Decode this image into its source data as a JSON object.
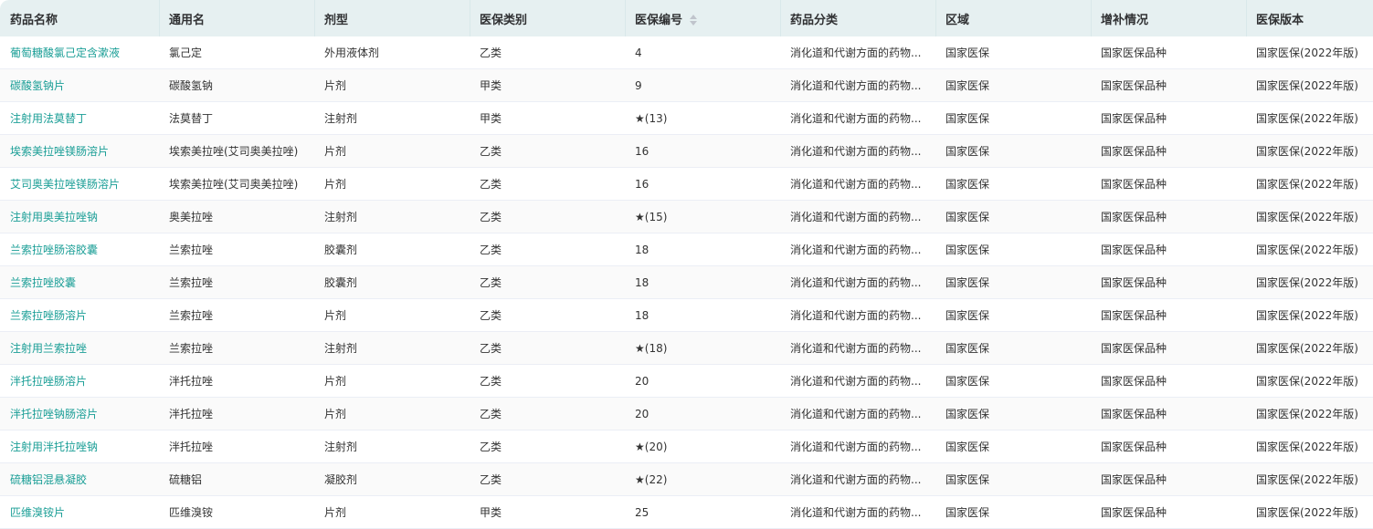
{
  "colors": {
    "link": "#1a9e96",
    "header_bg": "#e6f0f1",
    "stripe": "#fafafa",
    "text": "#333333"
  },
  "table": {
    "headers": [
      "药品名称",
      "通用名",
      "剂型",
      "医保类别",
      "医保编号",
      "药品分类",
      "区域",
      "增补情况",
      "医保版本"
    ],
    "sortable_column": "医保编号",
    "sort_icon": "sort-caret-icon",
    "rows": [
      [
        "葡萄糖酸氯己定含漱液",
        "氯己定",
        "外用液体剂",
        "乙类",
        "4",
        "消化道和代谢方面的药物...",
        "国家医保",
        "国家医保品种",
        "国家医保(2022年版)"
      ],
      [
        "碳酸氢钠片",
        "碳酸氢钠",
        "片剂",
        "甲类",
        "9",
        "消化道和代谢方面的药物...",
        "国家医保",
        "国家医保品种",
        "国家医保(2022年版)"
      ],
      [
        "注射用法莫替丁",
        "法莫替丁",
        "注射剂",
        "甲类",
        "★(13)",
        "消化道和代谢方面的药物...",
        "国家医保",
        "国家医保品种",
        "国家医保(2022年版)"
      ],
      [
        "埃索美拉唑镁肠溶片",
        "埃索美拉唑(艾司奥美拉唑)",
        "片剂",
        "乙类",
        "16",
        "消化道和代谢方面的药物...",
        "国家医保",
        "国家医保品种",
        "国家医保(2022年版)"
      ],
      [
        "艾司奥美拉唑镁肠溶片",
        "埃索美拉唑(艾司奥美拉唑)",
        "片剂",
        "乙类",
        "16",
        "消化道和代谢方面的药物...",
        "国家医保",
        "国家医保品种",
        "国家医保(2022年版)"
      ],
      [
        "注射用奥美拉唑钠",
        "奥美拉唑",
        "注射剂",
        "乙类",
        "★(15)",
        "消化道和代谢方面的药物...",
        "国家医保",
        "国家医保品种",
        "国家医保(2022年版)"
      ],
      [
        "兰索拉唑肠溶胶囊",
        "兰索拉唑",
        "胶囊剂",
        "乙类",
        "18",
        "消化道和代谢方面的药物...",
        "国家医保",
        "国家医保品种",
        "国家医保(2022年版)"
      ],
      [
        "兰索拉唑胶囊",
        "兰索拉唑",
        "胶囊剂",
        "乙类",
        "18",
        "消化道和代谢方面的药物...",
        "国家医保",
        "国家医保品种",
        "国家医保(2022年版)"
      ],
      [
        "兰索拉唑肠溶片",
        "兰索拉唑",
        "片剂",
        "乙类",
        "18",
        "消化道和代谢方面的药物...",
        "国家医保",
        "国家医保品种",
        "国家医保(2022年版)"
      ],
      [
        "注射用兰索拉唑",
        "兰索拉唑",
        "注射剂",
        "乙类",
        "★(18)",
        "消化道和代谢方面的药物...",
        "国家医保",
        "国家医保品种",
        "国家医保(2022年版)"
      ],
      [
        "泮托拉唑肠溶片",
        "泮托拉唑",
        "片剂",
        "乙类",
        "20",
        "消化道和代谢方面的药物...",
        "国家医保",
        "国家医保品种",
        "国家医保(2022年版)"
      ],
      [
        "泮托拉唑钠肠溶片",
        "泮托拉唑",
        "片剂",
        "乙类",
        "20",
        "消化道和代谢方面的药物...",
        "国家医保",
        "国家医保品种",
        "国家医保(2022年版)"
      ],
      [
        "注射用泮托拉唑钠",
        "泮托拉唑",
        "注射剂",
        "乙类",
        "★(20)",
        "消化道和代谢方面的药物...",
        "国家医保",
        "国家医保品种",
        "国家医保(2022年版)"
      ],
      [
        "硫糖铝混悬凝胶",
        "硫糖铝",
        "凝胶剂",
        "乙类",
        "★(22)",
        "消化道和代谢方面的药物...",
        "国家医保",
        "国家医保品种",
        "国家医保(2022年版)"
      ],
      [
        "匹维溴铵片",
        "匹维溴铵",
        "片剂",
        "甲类",
        "25",
        "消化道和代谢方面的药物...",
        "国家医保",
        "国家医保品种",
        "国家医保(2022年版)"
      ]
    ]
  }
}
